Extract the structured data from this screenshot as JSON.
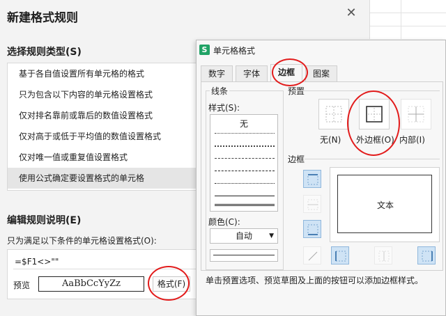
{
  "background_dialog": {
    "title": "新建格式规则",
    "close_glyph": "✕",
    "rule_type_heading": "选择规则类型(S)",
    "rule_types": [
      "基于各自值设置所有单元格的格式",
      "只为包含以下内容的单元格设置格式",
      "仅对排名靠前或靠后的数值设置格式",
      "仅对高于或低于平均值的数值设置格式",
      "仅对唯一值或重复值设置格式",
      "使用公式确定要设置格式的单元格"
    ],
    "selected_rule_index": 5,
    "edit_heading": "编辑规则说明(E)",
    "condition_label": "只为满足以下条件的单元格设置格式(O):",
    "formula_value": "=$F1<>\"\"",
    "preview_label": "预览",
    "preview_sample": "AaBbCcYyZz",
    "format_button": "格式(F)"
  },
  "format_cells_dialog": {
    "app_icon": "S",
    "title": "单元格格式",
    "tabs": [
      "数字",
      "字体",
      "边框",
      "图案"
    ],
    "active_tab": "边框",
    "line_group_label": "线条",
    "style_label": "样式(S):",
    "style_none": "无",
    "color_label": "颜色(C):",
    "color_value": "自动",
    "preset_group_label": "预置",
    "presets": [
      {
        "label": "无(N)",
        "icon": "border-none-icon"
      },
      {
        "label": "外边框(O)",
        "icon": "border-outline-icon"
      },
      {
        "label": "内部(I)",
        "icon": "border-inside-icon"
      }
    ],
    "border_group_label": "边框",
    "preview_text": "文本",
    "hint": "单击预置选项、预览草图及上面的按钮可以添加边框样式。"
  },
  "colors": {
    "annotation": "#e21b1b",
    "app_icon_bg": "#21a366",
    "toggle_on": "#cfe3f5"
  }
}
